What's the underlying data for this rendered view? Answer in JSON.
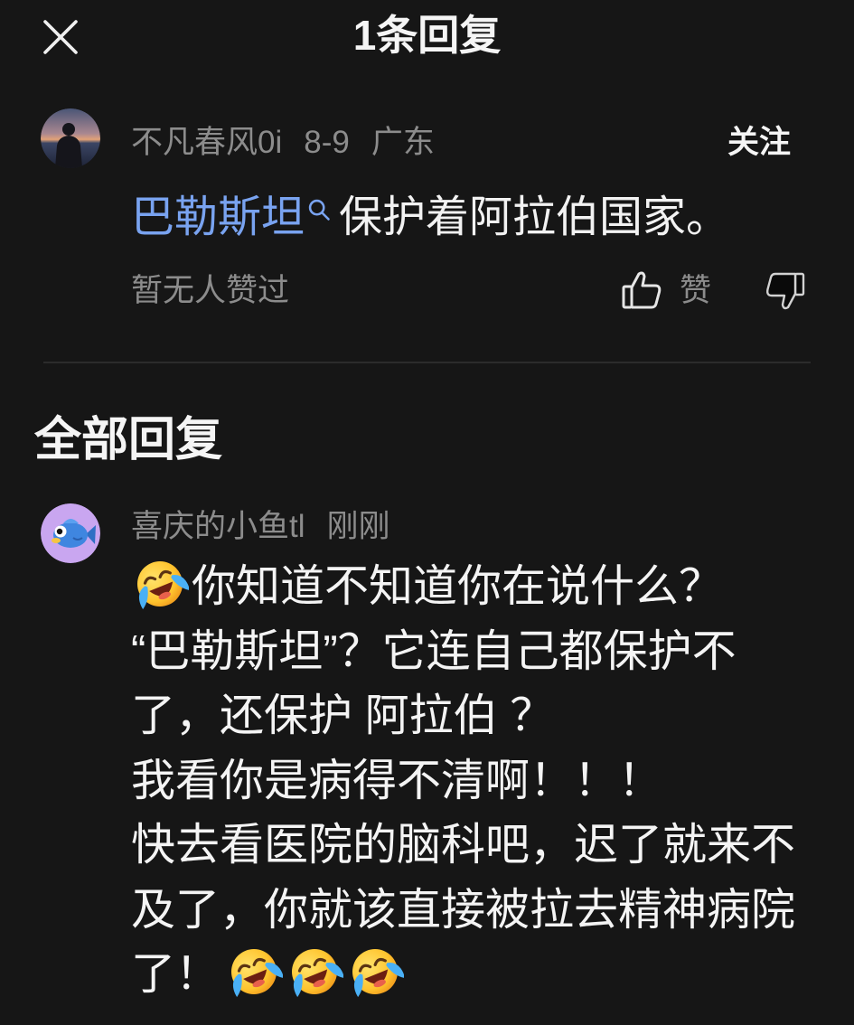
{
  "header": {
    "title": "1条回复",
    "close_icon": "close-icon"
  },
  "comment": {
    "avatar": "avatar-photo",
    "username": "不凡春风0i",
    "date": "8-9",
    "location": "广东",
    "follow_label": "关注",
    "text": {
      "link": "巴勒斯坦",
      "link_icon": "search-icon",
      "rest": "保护着阿拉伯国家。"
    },
    "likes_text": "暂无人赞过",
    "like_icon": "thumbs-up-icon",
    "like_label": "赞",
    "dislike_icon": "thumbs-down-icon"
  },
  "replies": {
    "heading": "全部回复",
    "items": [
      {
        "avatar": "fish-avatar",
        "username": "喜庆的小鱼tl",
        "time": "刚刚",
        "lines": [
          [
            {
              "emoji": "laugh-cry-emoji"
            },
            {
              "text": "你知道不知道你在说什么？"
            }
          ],
          [
            {
              "text": "“巴勒斯坦”？它连自己都保护不"
            }
          ],
          [
            {
              "text": "了，还保护 阿拉伯 ？"
            }
          ],
          [
            {
              "text": "我看你是病得不清啊！！！"
            }
          ],
          [
            {
              "text": "快去看医院的脑科吧，迟了就来不"
            }
          ],
          [
            {
              "text": "及了，你就该直接被拉去精神病院"
            }
          ],
          [
            {
              "text": "了！"
            },
            {
              "emoji": "laugh-cry-emoji"
            },
            {
              "emoji": "laugh-cry-emoji"
            },
            {
              "emoji": "laugh-cry-emoji"
            }
          ]
        ]
      }
    ]
  },
  "colors": {
    "background": "#161616",
    "text": "#f2f2f2",
    "muted": "#8c8c8c",
    "link": "#79a3f0",
    "divider": "#2b2b2b"
  }
}
